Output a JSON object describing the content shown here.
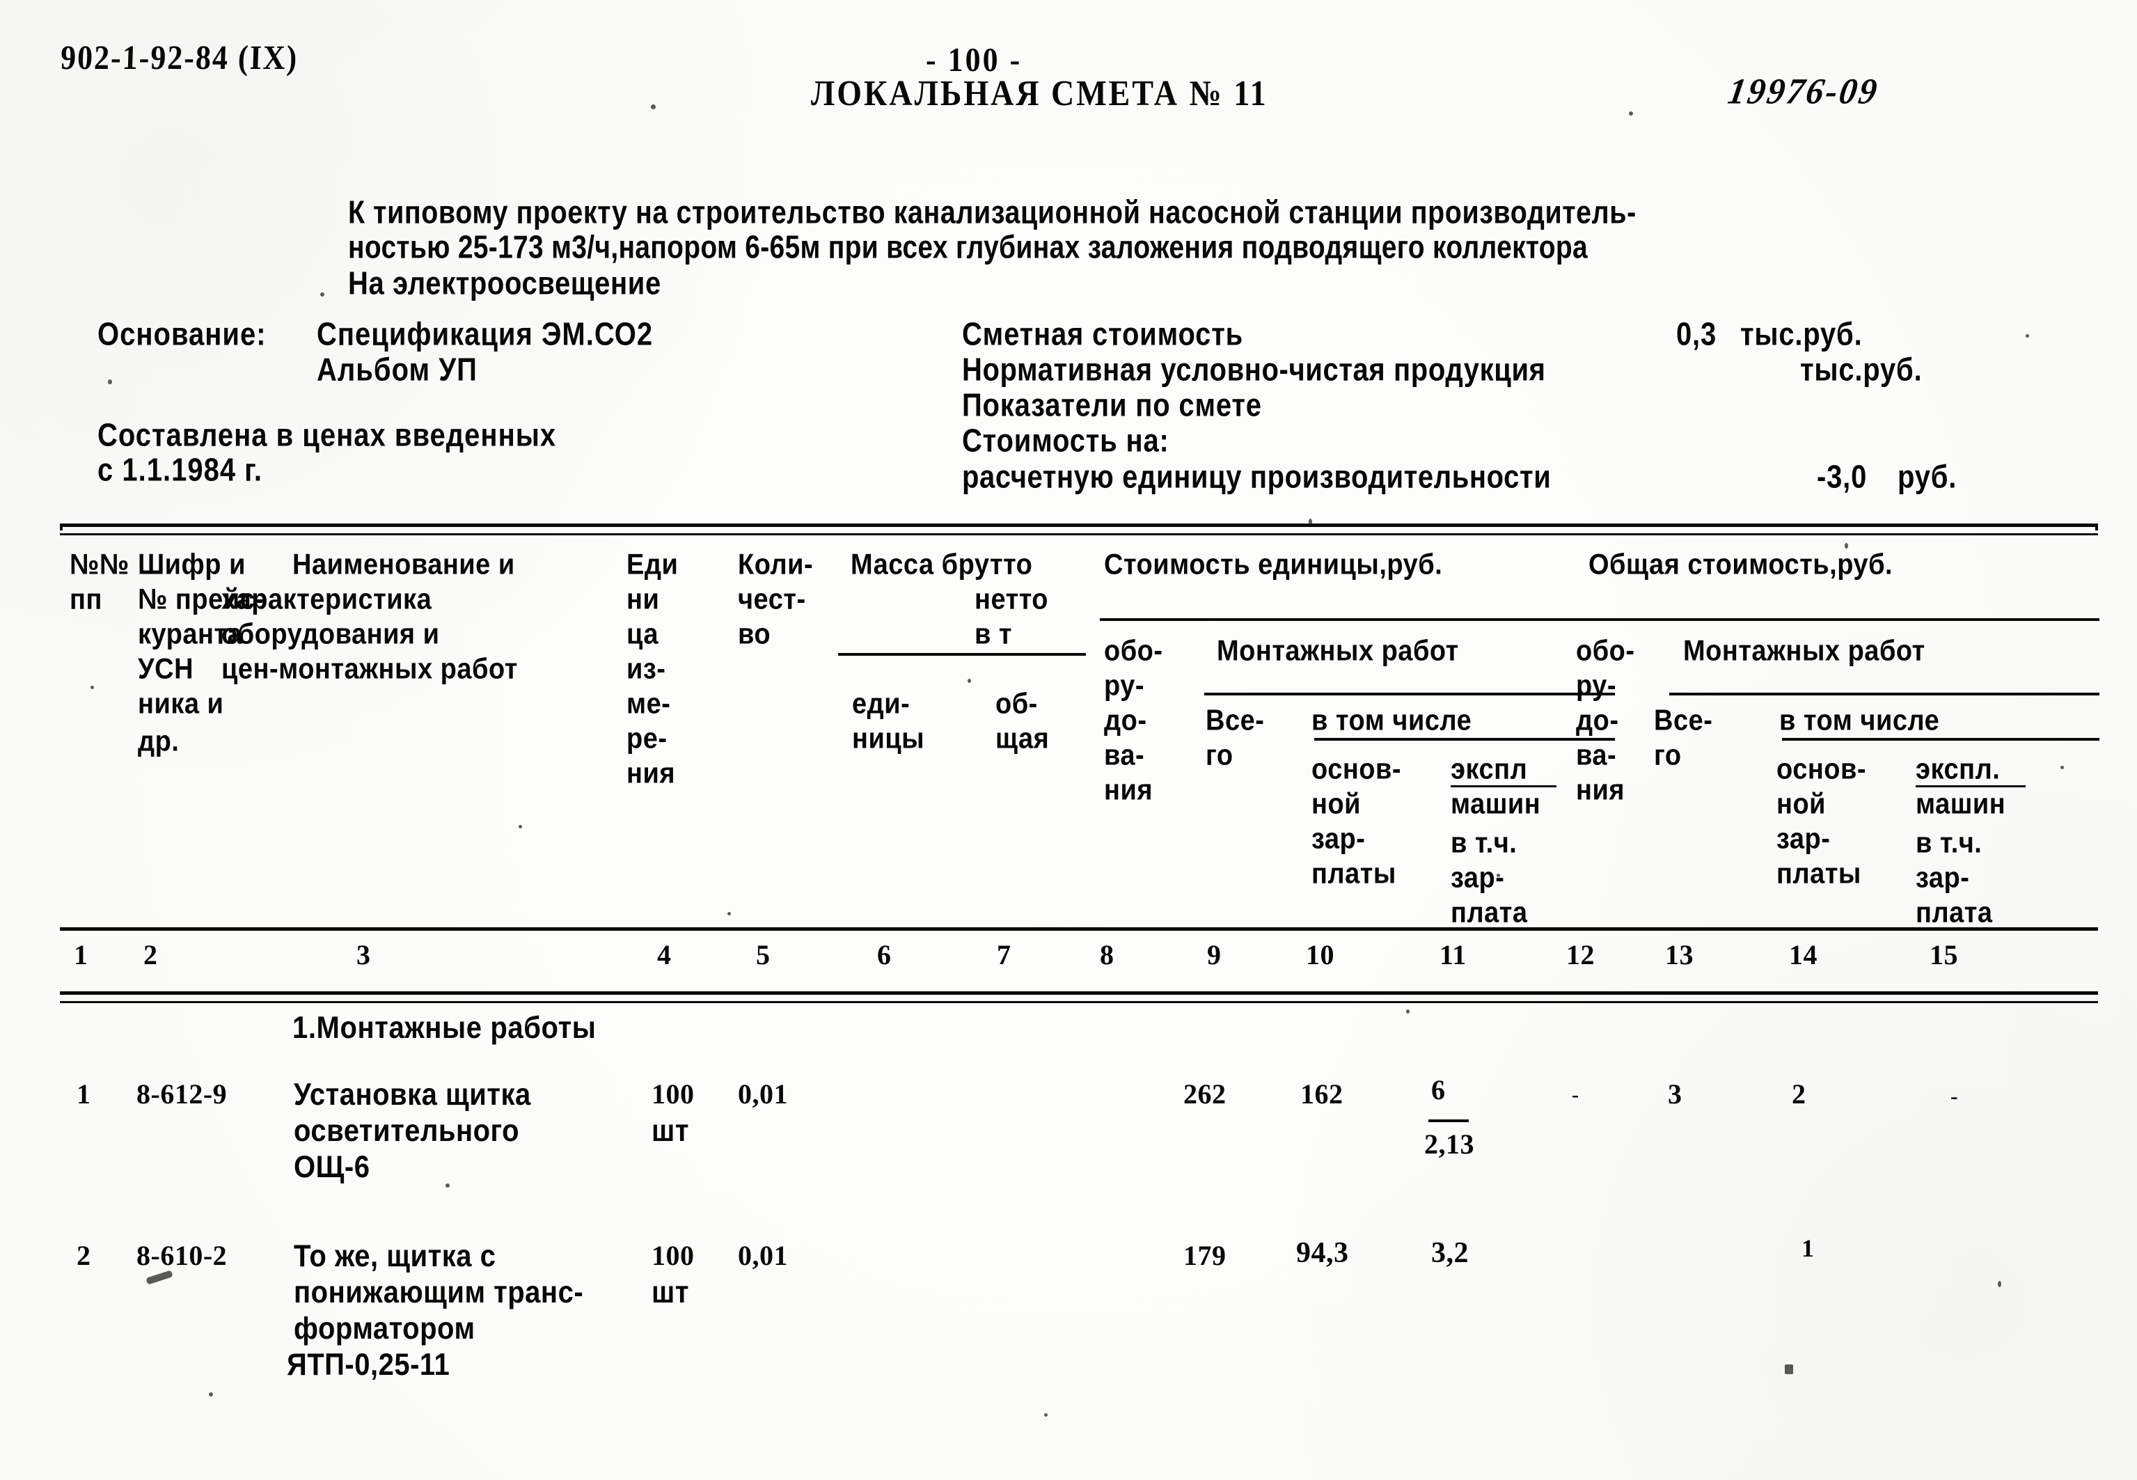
{
  "document": {
    "series_code": "902-1-92-84 (IX)",
    "page_number": "- 100 -",
    "title": "ЛОКАЛЬНАЯ СМЕТА № 11",
    "stamp_number": "19976-09",
    "description_line1": "К типовому проекту на строительство канализационной насосной станции производитель-",
    "description_line2": "ностью 25-173 м3/ч,напором 6-65м при всех глубинах заложения подводящего коллектора",
    "description_line3": "На электроосвещение"
  },
  "left_block": {
    "basis_label": "Основание:",
    "basis_value": "Спецификация ЭМ.СО2",
    "basis_value2": "Альбом УП",
    "prices_line1": "Составлена в ценах введенных",
    "prices_line2": "с 1.1.1984 г."
  },
  "right_block": {
    "rows": [
      {
        "label": "Сметная стоимость",
        "value": "0,3",
        "unit": "тыс.руб."
      },
      {
        "label": "Нормативная условно-чистая продукция",
        "value": "",
        "unit": "тыс.руб."
      },
      {
        "label": "Показатели по смете",
        "value": "",
        "unit": ""
      },
      {
        "label": "Стоимость на:",
        "value": "",
        "unit": ""
      },
      {
        "label": "расчетную единицу производительности",
        "value": "-3,0",
        "unit": "руб."
      }
    ]
  },
  "table": {
    "headers": {
      "col1": [
        "№№",
        "пп"
      ],
      "col2": [
        "Шифр и",
        "№ прейс-",
        "куранта",
        "УСН",
        "ника и",
        "др."
      ],
      "col3": [
        "Наименование и",
        "характеристика",
        "оборудования и",
        "цен-монтажных работ"
      ],
      "col4": [
        "Еди",
        "ни",
        "ца",
        "из-",
        "ме-",
        "ре-",
        "ния"
      ],
      "col5": [
        "Коли-",
        "чест-",
        "во"
      ],
      "group_mass": [
        "Масса брутто",
        "нетто",
        "в т"
      ],
      "col6": [
        "еди-",
        "ницы"
      ],
      "col7": [
        "об-",
        "щая"
      ],
      "group_unit_cost": "Стоимость единицы,руб.",
      "col8": [
        "обо-",
        "ру-",
        "до-",
        "ва-",
        "ния"
      ],
      "group_mount_unit": "Монтажных работ",
      "col9": [
        "Все-",
        "го"
      ],
      "subgroup_unit": "в том числе",
      "col10": [
        "основ-",
        "ной",
        "зар-",
        "платы"
      ],
      "col11": [
        "экспл",
        "машин",
        "в т.ч.",
        "зар-",
        "плата"
      ],
      "group_total_cost": "Общая стоимость,руб.",
      "col12": [
        "обо-",
        "ру-",
        "до-",
        "ва-",
        "ния"
      ],
      "group_mount_total": "Монтажных работ",
      "col13": [
        "Все-",
        "го"
      ],
      "subgroup_total": "в том числе",
      "col14": [
        "основ-",
        "ной",
        "зар-",
        "платы"
      ],
      "col15": [
        "экспл.",
        "машин",
        "в т.ч.",
        "зар-",
        "плата"
      ]
    },
    "column_numbers": [
      "1",
      "2",
      "3",
      "4",
      "5",
      "6",
      "7",
      "8",
      "9",
      "10",
      "11",
      "12",
      "13",
      "14",
      "15"
    ],
    "section_title": "1.Монтажные работы",
    "rows": [
      {
        "c1": "1",
        "c2": "8-612-9",
        "c3": [
          "Установка щитка",
          "осветительного",
          "ОЩ-6"
        ],
        "c4": [
          "100",
          "шт"
        ],
        "c5": "0,01",
        "c6": "",
        "c7": "",
        "c8": "",
        "c9": "262",
        "c10": "162",
        "c11_num": "6",
        "c11_den": "2,13",
        "c12": "-",
        "c13": "3",
        "c14": "2",
        "c15": "-"
      },
      {
        "c1": "2",
        "c2": "8-610-2",
        "c3": [
          "То же, щитка с",
          "понижающим транс-",
          "форматором",
          "ЯТП-0,25-11"
        ],
        "c4": [
          "100",
          "шт"
        ],
        "c5": "0,01",
        "c6": "",
        "c7": "",
        "c8": "",
        "c9": "179",
        "c10": "94,3",
        "c11_num": "3,2",
        "c11_den": "",
        "c12": "",
        "c13": "",
        "c14": "1",
        "c15": ""
      }
    ]
  }
}
